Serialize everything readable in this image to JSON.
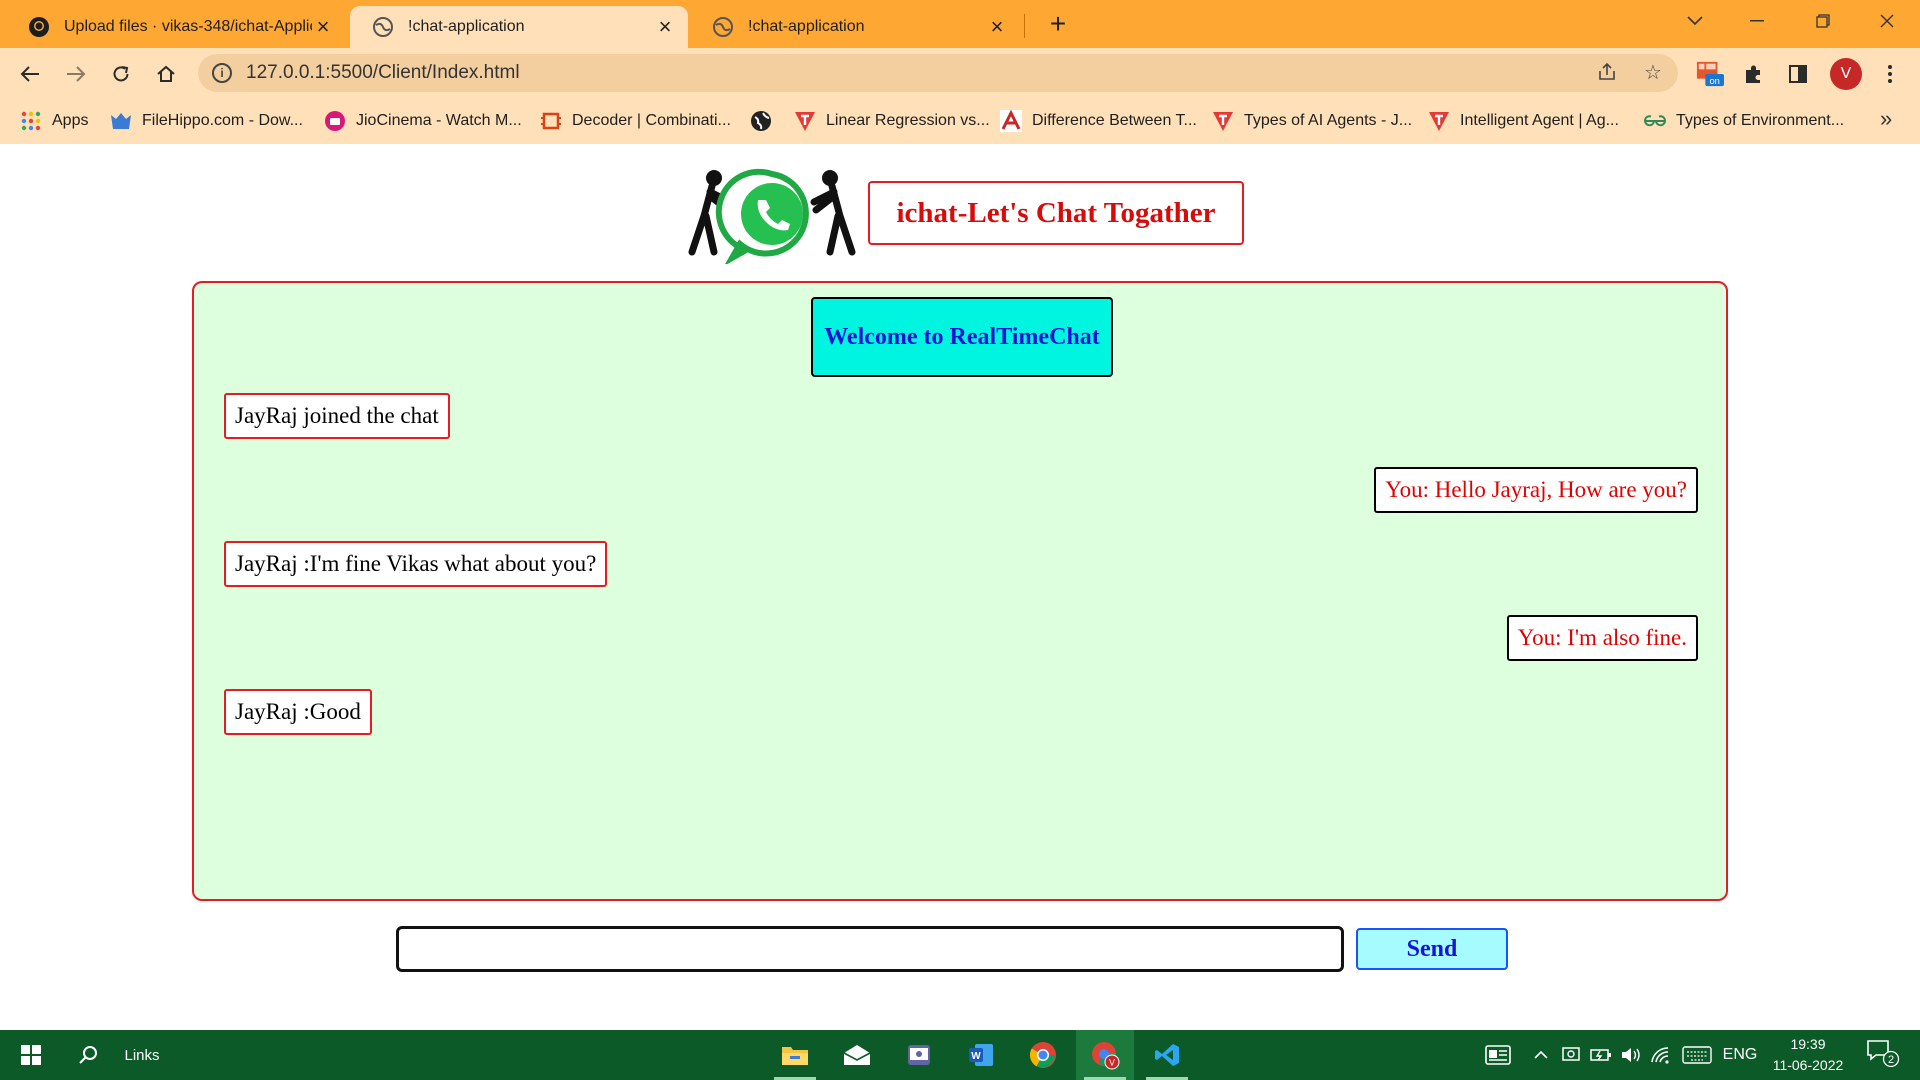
{
  "browser": {
    "tabs": [
      {
        "title": "Upload files · vikas-348/ichat-Applic",
        "active": false,
        "icon": "github-icon"
      },
      {
        "title": "!chat-application",
        "active": true,
        "icon": "globe-icon"
      },
      {
        "title": "!chat-application",
        "active": false,
        "icon": "globe-icon"
      }
    ],
    "url": "127.0.0.1:5500/Client/Index.html",
    "profile_initial": "V",
    "extension_badge": "on",
    "bookmarks": [
      {
        "label": "Apps",
        "icon": "apps-grid-icon"
      },
      {
        "label": "FileHippo.com - Dow...",
        "icon": "filehippo-icon"
      },
      {
        "label": "JioCinema - Watch M...",
        "icon": "jiocinema-icon"
      },
      {
        "label": "Decoder | Combinati...",
        "icon": "decoder-icon"
      },
      {
        "label": "",
        "icon": "globe-bookmark-icon"
      },
      {
        "label": "Linear Regression vs...",
        "icon": "javatpoint-icon"
      },
      {
        "label": "Difference Between T...",
        "icon": "a-logo-icon"
      },
      {
        "label": "Types of AI Agents - J...",
        "icon": "javatpoint-icon"
      },
      {
        "label": "Intelligent Agent | Ag...",
        "icon": "javatpoint-icon"
      },
      {
        "label": "Types of Environment...",
        "icon": "gfg-icon"
      }
    ]
  },
  "app": {
    "title": "ichat-Let's Chat Togather",
    "welcome": "Welcome to RealTimeChat",
    "messages": [
      {
        "side": "left",
        "text": "JayRaj joined the chat"
      },
      {
        "side": "right",
        "text": "You: Hello Jayraj, How are you?"
      },
      {
        "side": "left",
        "text": "JayRaj :I'm fine Vikas what about you?"
      },
      {
        "side": "right",
        "text": "You: I'm also fine."
      },
      {
        "side": "left",
        "text": "JayRaj :Good"
      }
    ],
    "input_value": "",
    "send_label": "Send"
  },
  "taskbar": {
    "search_label": "Links",
    "language": "ENG",
    "time": "19:39",
    "date": "11-06-2022",
    "notification_count": "2"
  },
  "colors": {
    "tab_strip": "#ffa733",
    "toolbar": "#ffe0b8",
    "chat_bg": "#ddffdd",
    "accent_red": "#e51c23",
    "welcome_bg": "#00f5e0",
    "send_bg": "#a6fbff",
    "taskbar": "#0b5a27"
  }
}
